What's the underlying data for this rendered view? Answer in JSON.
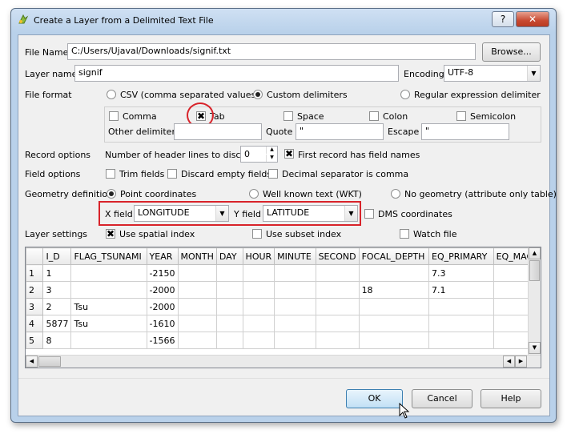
{
  "window": {
    "title": "Create a Layer from a Delimited Text File",
    "help_btn": "?",
    "close_btn": "✕"
  },
  "file_name": {
    "label": "File Name",
    "value": "C:/Users/Ujaval/Downloads/signif.txt",
    "browse": "Browse..."
  },
  "layer_name": {
    "label": "Layer name",
    "value": "signif",
    "encoding_label": "Encoding",
    "encoding_value": "UTF-8"
  },
  "file_format": {
    "label": "File format",
    "options": [
      "CSV (comma separated values)",
      "Custom delimiters",
      "Regular expression delimiter"
    ],
    "selected": "Custom delimiters"
  },
  "delimiters": {
    "comma": "Comma",
    "tab": "Tab",
    "space": "Space",
    "colon": "Colon",
    "semicolon": "Semicolon",
    "other_label": "Other delimiters",
    "other_value": "",
    "quote_label": "Quote",
    "quote_value": "\"",
    "escape_label": "Escape",
    "escape_value": "\""
  },
  "record_options": {
    "label": "Record options",
    "header_lines_label": "Number of header lines to discard",
    "header_lines_value": "0",
    "first_record_label": "First record has field names"
  },
  "field_options": {
    "label": "Field options",
    "trim": "Trim fields",
    "discard_empty": "Discard empty fields",
    "decimal": "Decimal separator is comma"
  },
  "geometry": {
    "label": "Geometry definition",
    "options": [
      "Point coordinates",
      "Well known text (WKT)",
      "No geometry (attribute only table)"
    ],
    "selected": "Point coordinates",
    "x_label": "X field",
    "x_value": "LONGITUDE",
    "y_label": "Y field",
    "y_value": "LATITUDE",
    "dms_label": "DMS coordinates"
  },
  "layer_settings": {
    "label": "Layer settings",
    "spatial_index": "Use spatial index",
    "subset_index": "Use subset index",
    "watch_file": "Watch file"
  },
  "table": {
    "headers": [
      "I_D",
      "FLAG_TSUNAMI",
      "YEAR",
      "MONTH",
      "DAY",
      "HOUR",
      "MINUTE",
      "SECOND",
      "FOCAL_DEPTH",
      "EQ_PRIMARY",
      "EQ_MAG"
    ],
    "rows": [
      {
        "n": "1",
        "cells": [
          "1",
          "",
          "-2150",
          "",
          "",
          "",
          "",
          "",
          "",
          "7.3",
          ""
        ]
      },
      {
        "n": "2",
        "cells": [
          "3",
          "",
          "-2000",
          "",
          "",
          "",
          "",
          "",
          "18",
          "7.1",
          ""
        ]
      },
      {
        "n": "3",
        "cells": [
          "2",
          "Tsu",
          "-2000",
          "",
          "",
          "",
          "",
          "",
          "",
          "",
          ""
        ]
      },
      {
        "n": "4",
        "cells": [
          "5877",
          "Tsu",
          "-1610",
          "",
          "",
          "",
          "",
          "",
          "",
          "",
          ""
        ]
      },
      {
        "n": "5",
        "cells": [
          "8",
          "",
          "-1566",
          "",
          "",
          "",
          "",
          "",
          "",
          "",
          ""
        ]
      }
    ]
  },
  "buttons": {
    "ok": "OK",
    "cancel": "Cancel",
    "help": "Help"
  },
  "colors": {
    "highlight": "#d8232a",
    "title_bar": "#b9d1ea"
  }
}
